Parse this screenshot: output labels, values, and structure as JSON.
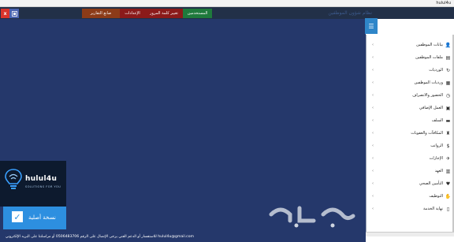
{
  "window": {
    "title": "hulul4u"
  },
  "topbar": {
    "close_label": "x",
    "app_icon": "app-icon",
    "app_title": "نظام شؤون الموظفين",
    "menu": [
      {
        "label": "صانع التقارير",
        "color": "#8c3b18"
      },
      {
        "label": "الإعدادات",
        "color": "#8b1a1a"
      },
      {
        "label": "تغيير كلمة المرور",
        "color": "#8b1a1a"
      },
      {
        "label": "المستخدمين",
        "color": "#1f7a3c"
      }
    ]
  },
  "sidebar": {
    "toggle_icon": "hamburger-icon",
    "items": [
      {
        "label": "بيانات الموظفين",
        "icon": "user-icon"
      },
      {
        "label": "ملفات الموظفين",
        "icon": "folder-icon"
      },
      {
        "label": "الورديات",
        "icon": "refresh-icon"
      },
      {
        "label": "ورديات الموظفين",
        "icon": "calendar-user-icon"
      },
      {
        "label": "الحضور والانصراف",
        "icon": "clock-icon"
      },
      {
        "label": "العمل الإضافي",
        "icon": "briefcase-icon"
      },
      {
        "label": "السلف",
        "icon": "money-icon"
      },
      {
        "label": "المكافآت والعقوبات",
        "icon": "trophy-icon"
      },
      {
        "label": "الرواتب",
        "icon": "dollar-icon"
      },
      {
        "label": "الإجازات",
        "icon": "plane-icon"
      },
      {
        "label": "العهد",
        "icon": "box-icon"
      },
      {
        "label": "التأمين الصحي",
        "icon": "heart-icon"
      },
      {
        "label": "التوظيف",
        "icon": "handshake-icon"
      },
      {
        "label": "نهاية الخدمة",
        "icon": "door-icon"
      }
    ]
  },
  "logo": {
    "name": "hulul4u",
    "tagline": "SOLUTIONS FOR YOU"
  },
  "badge": {
    "label": "نسخة أصلية",
    "check": "✓"
  },
  "footer": {
    "contact": "للاستفسار أو الدعم الفني يرجى الإتصال على الرقم 0506483706 أو مراسلتنا على البريد الإلكتروني hulul4u@gmail.com"
  },
  "colors": {
    "main_bg": "#25386b",
    "topbar_bg": "#223048",
    "accent": "#2d8fe0"
  }
}
